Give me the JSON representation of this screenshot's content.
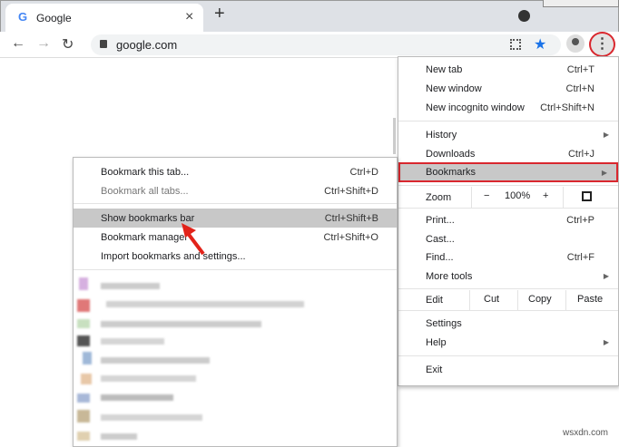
{
  "tab": {
    "title": "Google",
    "close": "×",
    "new_tab": "+"
  },
  "toolbar": {
    "url": "google.com"
  },
  "menu": {
    "items1": [
      {
        "label": "New tab",
        "sc": "Ctrl+T"
      },
      {
        "label": "New window",
        "sc": "Ctrl+N"
      },
      {
        "label": "New incognito window",
        "sc": "Ctrl+Shift+N"
      }
    ],
    "history": "History",
    "downloads": {
      "label": "Downloads",
      "sc": "Ctrl+J"
    },
    "bookmarks": "Bookmarks",
    "zoom": {
      "label": "Zoom",
      "minus": "−",
      "value": "100%",
      "plus": "+"
    },
    "print": {
      "label": "Print...",
      "sc": "Ctrl+P"
    },
    "cast": "Cast...",
    "find": {
      "label": "Find...",
      "sc": "Ctrl+F"
    },
    "more_tools": "More tools",
    "edit": {
      "label": "Edit",
      "cut": "Cut",
      "copy": "Copy",
      "paste": "Paste"
    },
    "settings": "Settings",
    "help": "Help",
    "exit": "Exit"
  },
  "submenu": {
    "items": [
      {
        "label": "Bookmark this tab...",
        "sc": "Ctrl+D"
      },
      {
        "label": "Bookmark all tabs...",
        "sc": "Ctrl+Shift+D"
      },
      {
        "label": "Show bookmarks bar",
        "sc": "Ctrl+Shift+B"
      },
      {
        "label": "Bookmark manager",
        "sc": "Ctrl+Shift+O"
      },
      {
        "label": "Import bookmarks and settings..."
      }
    ]
  },
  "watermark": "wsxdn.com",
  "colors": {
    "highlight_border": "#d9272e",
    "star": "#1a73e8"
  }
}
